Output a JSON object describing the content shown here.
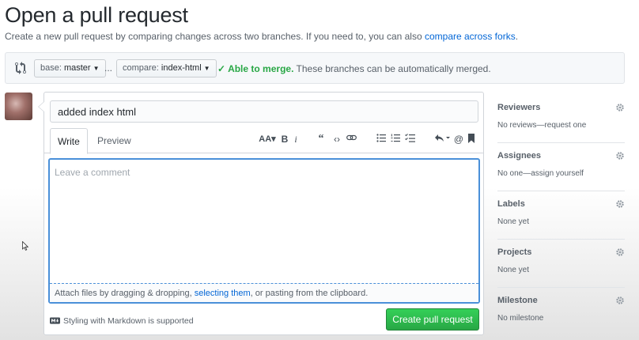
{
  "page": {
    "title": "Open a pull request",
    "subtitle_text": "Create a new pull request by comparing changes across two branches. If you need to, you can also ",
    "subtitle_link": "compare across forks",
    "subtitle_end": "."
  },
  "compare": {
    "base_prefix": "base: ",
    "base_branch": "master",
    "ellipsis": "...",
    "compare_prefix": "compare: ",
    "compare_branch": "index-html",
    "merge_ok": "Able to merge.",
    "merge_msg": " These branches can be automatically merged."
  },
  "editor": {
    "title_value": "added index html",
    "tabs": [
      {
        "label": "Write",
        "active": true
      },
      {
        "label": "Preview",
        "active": false
      }
    ],
    "toolbar": [
      "header-icon",
      "bold-icon",
      "italic-icon",
      "quote-icon",
      "code-icon",
      "link-icon",
      "unordered-list-icon",
      "ordered-list-icon",
      "task-list-icon",
      "reply-icon",
      "mention-icon",
      "saved-reply-icon"
    ],
    "comment_placeholder": "Leave a comment",
    "attach_text_1": "Attach files by dragging & dropping, ",
    "attach_link": "selecting them",
    "attach_text_2": ", or pasting from the clipboard.",
    "markdown_note": "Styling with Markdown is supported",
    "submit_label": "Create pull request"
  },
  "sidebar": {
    "sections": [
      {
        "heading": "Reviewers",
        "value": "No reviews—request one"
      },
      {
        "heading": "Assignees",
        "value": "No one—assign yourself"
      },
      {
        "heading": "Labels",
        "value": "None yet"
      },
      {
        "heading": "Projects",
        "value": "None yet"
      },
      {
        "heading": "Milestone",
        "value": "No milestone"
      }
    ]
  },
  "colors": {
    "accent": "#0366d6",
    "success": "#28a745",
    "focus_border": "#4a90d9"
  }
}
